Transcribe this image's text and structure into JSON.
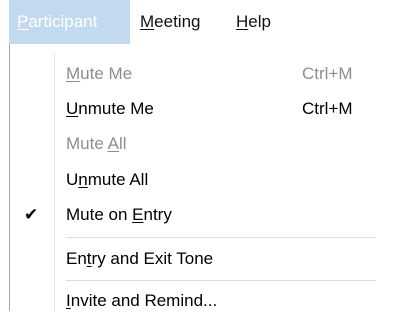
{
  "menubar": {
    "participant": {
      "pre": "",
      "u": "P",
      "post": "articipant"
    },
    "meeting": {
      "pre": "",
      "u": "M",
      "post": "eeting"
    },
    "help": {
      "pre": "",
      "u": "H",
      "post": "elp"
    }
  },
  "menu": {
    "mute_me": {
      "pre": "",
      "u": "M",
      "post": "ute Me",
      "shortcut": "Ctrl+M"
    },
    "unmute_me": {
      "pre": "",
      "u": "U",
      "post": "nmute Me",
      "shortcut": "Ctrl+M"
    },
    "mute_all": {
      "pre": "Mute ",
      "u": "A",
      "post": "ll"
    },
    "unmute_all": {
      "pre": "U",
      "u": "n",
      "post": "mute All"
    },
    "mute_on_entry": {
      "pre": "Mute on ",
      "u": "E",
      "post": "ntry",
      "check": "✔"
    },
    "entry_exit_tone": {
      "pre": "En",
      "u": "t",
      "post": "ry and Exit Tone"
    },
    "invite_remind": {
      "pre": "",
      "u": "I",
      "post": "nvite and Remind..."
    }
  },
  "colors": {
    "active_menubar_bg": "#c3d9ef",
    "disabled_text": "#8e8e8e"
  }
}
